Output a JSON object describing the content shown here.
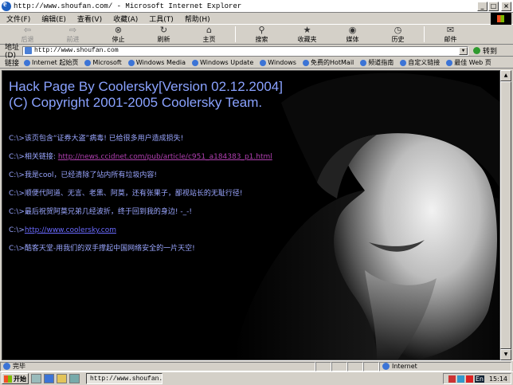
{
  "window": {
    "title": "http://www.shoufan.com/ - Microsoft Internet Explorer",
    "min": "_",
    "max": "□",
    "close": "×"
  },
  "menu": [
    "文件(F)",
    "编辑(E)",
    "查看(V)",
    "收藏(A)",
    "工具(T)",
    "帮助(H)"
  ],
  "toolbar": {
    "back": "后退",
    "forward": "前进",
    "stop": "停止",
    "refresh": "刷新",
    "home": "主页",
    "search": "搜索",
    "favorites": "收藏夹",
    "media": "媒体",
    "history": "历史",
    "mail": "邮件"
  },
  "address": {
    "label": "地址(D)",
    "value": "http://www.shoufan.com",
    "go": "转到"
  },
  "links": {
    "label": "链接",
    "items": [
      "Internet 起始页",
      "Microsoft",
      "Windows Media",
      "Windows Update",
      "Windows",
      "免费的HotMail",
      "频道指南",
      "自定义链接",
      "最佳 Web 页"
    ]
  },
  "page": {
    "heading1": "Hack Page By Coolersky[Version 02.12.2004]",
    "heading2": "(C) Copyright 2001-2005 Coolersky Team.",
    "prefix": "C:\\>",
    "line1": "该页包含“证券大盗”病毒! 已给很多用户造成损失!",
    "line2_label": "相关链接:",
    "line2_link": "http://news.ccidnet.com/pub/article/c951_a184383_p1.html",
    "line3": "我是cool，已经清除了站内所有垃圾内容!",
    "line4": "顺便代阿道、无言、老黑、阿莫，还有张果子，鄙视站长的无耻行径!",
    "line5": "最后祝贺阿莫兄弟几经波折，终于回到我的身边! -_-!",
    "line6_link": "http://www.coolersky.com",
    "line7": "酷客天堂-用我们的双手撑起中国网络安全的一片天空!"
  },
  "status": {
    "text": "完毕",
    "zone": "Internet"
  },
  "taskbar": {
    "start": "开始",
    "task": "http://www.shoufan....",
    "time": "15:14",
    "lang": "En"
  },
  "colors": {
    "heading": "#8aa2ff",
    "text": "#9aa6ff",
    "link": "#6a6aff",
    "visited_link": "#b040b0",
    "background": "#000000"
  }
}
